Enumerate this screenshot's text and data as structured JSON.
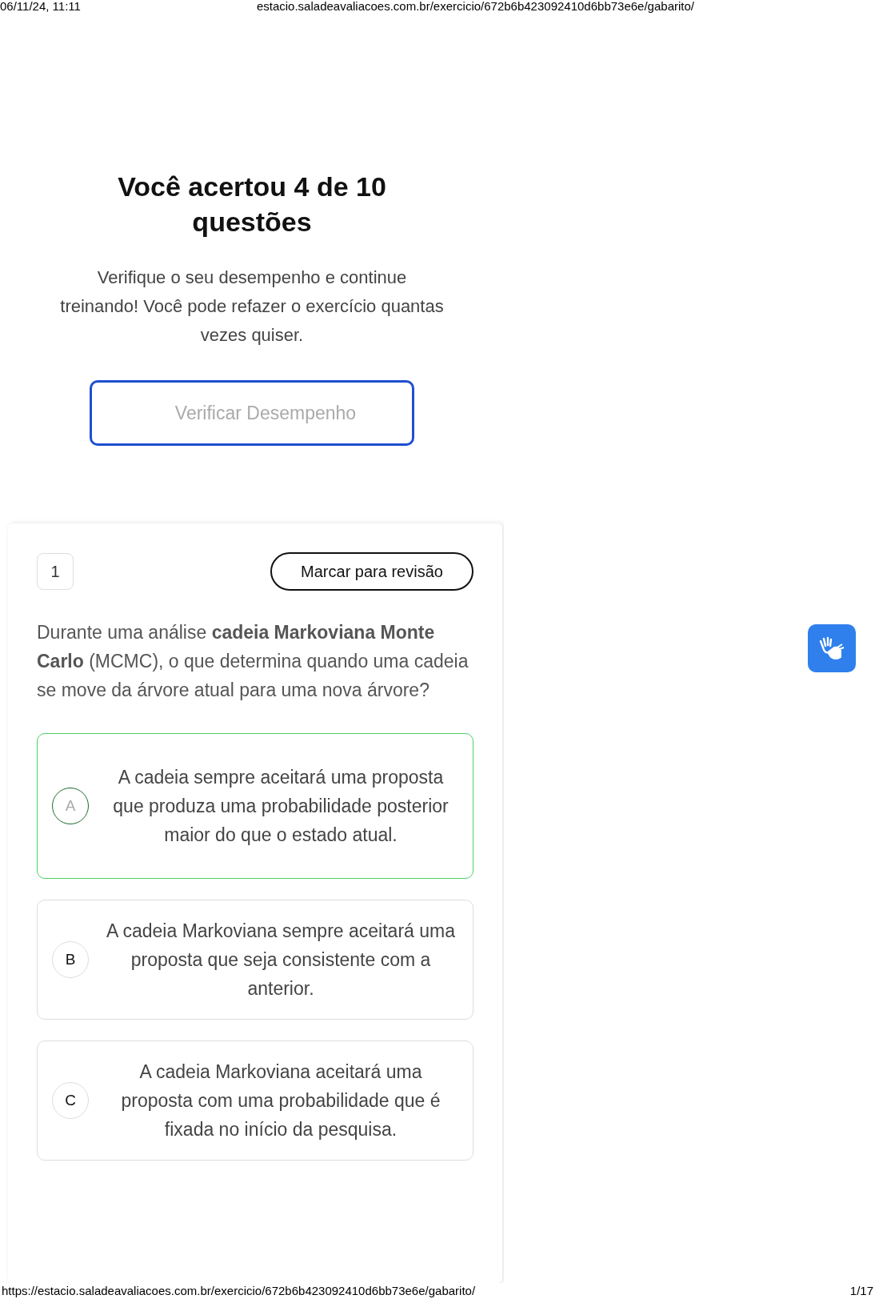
{
  "print_header": {
    "datetime": "06/11/24, 11:11",
    "url": "estacio.saladeavaliacoes.com.br/exercicio/672b6b423092410d6bb73e6e/gabarito/"
  },
  "result": {
    "title": "Você acertou 4 de 10 questões",
    "message": "Verifique o seu desempenho e continue treinando! Você pode refazer o exercício quantas vezes quiser.",
    "button": "Verificar Desempenho"
  },
  "question": {
    "number": "1",
    "review_button": "Marcar para revisão",
    "text": "Durante uma análise **cadeia Markoviana Monte Carlo** (MCMC), o que determina quando uma cadeia se move da árvore atual para uma nova árvore?",
    "options": [
      {
        "letter": "A",
        "text": "A cadeia sempre aceitará uma proposta que produza uma probabilidade posterior maior do que o estado atual.",
        "selected": true
      },
      {
        "letter": "B",
        "text": "A cadeia Markoviana sempre aceitará uma proposta que seja consistente com a anterior.",
        "selected": false
      },
      {
        "letter": "C",
        "text": "A cadeia Markoviana aceitará uma proposta com uma probabilidade que é fixada no início da pesquisa.",
        "selected": false
      }
    ]
  },
  "print_footer": {
    "url": "https://estacio.saladeavaliacoes.com.br/exercicio/672b6b423092410d6bb73e6e/gabarito/",
    "page": "1/17"
  }
}
